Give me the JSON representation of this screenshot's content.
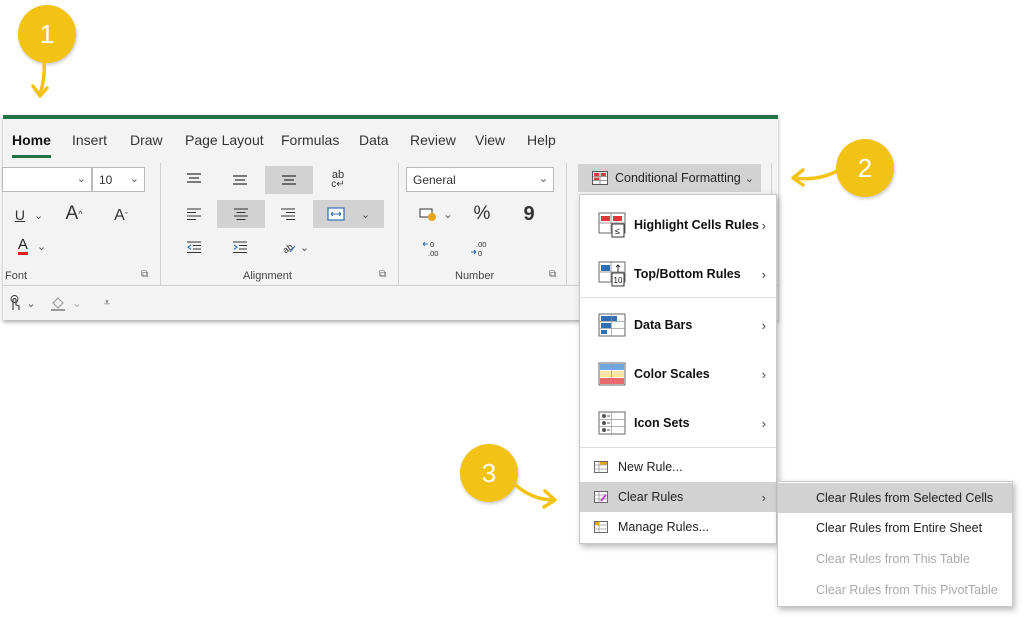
{
  "tabs": [
    "Home",
    "Insert",
    "Draw",
    "Page Layout",
    "Formulas",
    "Data",
    "Review",
    "View",
    "Help"
  ],
  "font": {
    "size_value": "10",
    "group_label": "Font",
    "underline_glyph": "U",
    "grow_glyph": "A",
    "shrink_glyph": "A",
    "color_glyph": "A"
  },
  "alignment": {
    "group_label": "Alignment",
    "wrap_glyph": "ab"
  },
  "number": {
    "format_value": "General",
    "percent_glyph": "%",
    "comma_glyph": "9",
    "group_label": "Number"
  },
  "conditional_formatting": {
    "label": "Conditional Formatting"
  },
  "menu": {
    "items": [
      {
        "label": "Highlight Cells Rules"
      },
      {
        "label": "Top/Bottom Rules"
      },
      {
        "label": "Data Bars"
      },
      {
        "label": "Color Scales"
      },
      {
        "label": "Icon Sets"
      }
    ],
    "new_rule": "New Rule...",
    "clear_rules": "Clear Rules",
    "manage_rules": "Manage Rules..."
  },
  "submenu": {
    "items": [
      {
        "label": "Clear Rules from Selected Cells",
        "state": "hover"
      },
      {
        "label": "Clear Rules from Entire Sheet",
        "state": "enabled"
      },
      {
        "label": "Clear Rules from This Table",
        "state": "disabled"
      },
      {
        "label": "Clear Rules from This PivotTable",
        "state": "disabled"
      }
    ]
  },
  "badges": [
    "1",
    "2",
    "3"
  ],
  "colors": {
    "accent_green": "#217346",
    "badge_yellow": "#F2C314",
    "hover_gray": "#D2D2D2"
  }
}
